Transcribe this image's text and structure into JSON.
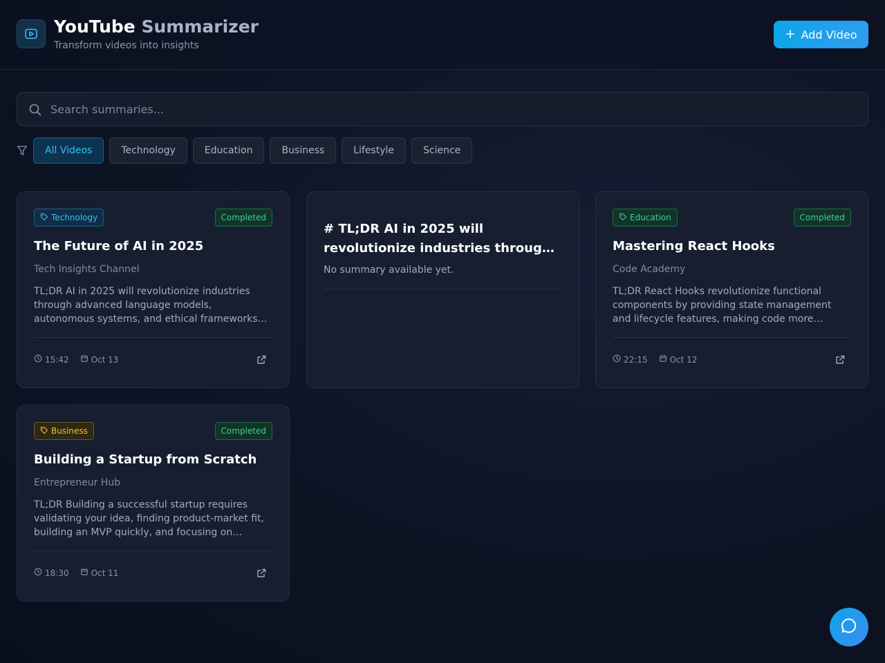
{
  "header": {
    "title_part1": "YouTube",
    "title_part2": "Summarizer",
    "subtitle": "Transform videos into insights",
    "add_button_icon": "+",
    "add_button_label": "Add Video"
  },
  "search": {
    "placeholder": "Search summaries...",
    "value": ""
  },
  "filters": [
    "All Videos",
    "Technology",
    "Education",
    "Business",
    "Lifestyle",
    "Science"
  ],
  "active_filter": "All Videos",
  "cards": [
    {
      "category": "Technology",
      "status": "Completed",
      "title": "The Future of AI in 2025",
      "channel": "Tech Insights Channel",
      "summary": "TL;DR AI in 2025 will revolutionize industries through advanced language models, autonomous systems, and ethical frameworks…",
      "duration": "15:42",
      "date": "Oct 13"
    },
    {
      "title": "# TL;DR AI in 2025 will revolutionize industries throug…",
      "summary": "No summary available yet."
    },
    {
      "category": "Education",
      "status": "Completed",
      "title": "Mastering React Hooks",
      "channel": "Code Academy",
      "summary": "TL;DR React Hooks revolutionize functional components by providing state management and lifecycle features, making code more…",
      "duration": "22:15",
      "date": "Oct 12"
    },
    {
      "category": "Business",
      "status": "Completed",
      "title": "Building a Startup from Scratch",
      "channel": "Entrepreneur Hub",
      "summary": "TL;DR Building a successful startup requires validating your idea, finding product-market fit, building an MVP quickly, and focusing on…",
      "duration": "18:30",
      "date": "Oct 11"
    }
  ],
  "colors": {
    "accent": "#0ea5e9",
    "technology": "#38bdf8",
    "education": "#34d399",
    "business": "#fbbf24",
    "completed": "#34d399"
  }
}
